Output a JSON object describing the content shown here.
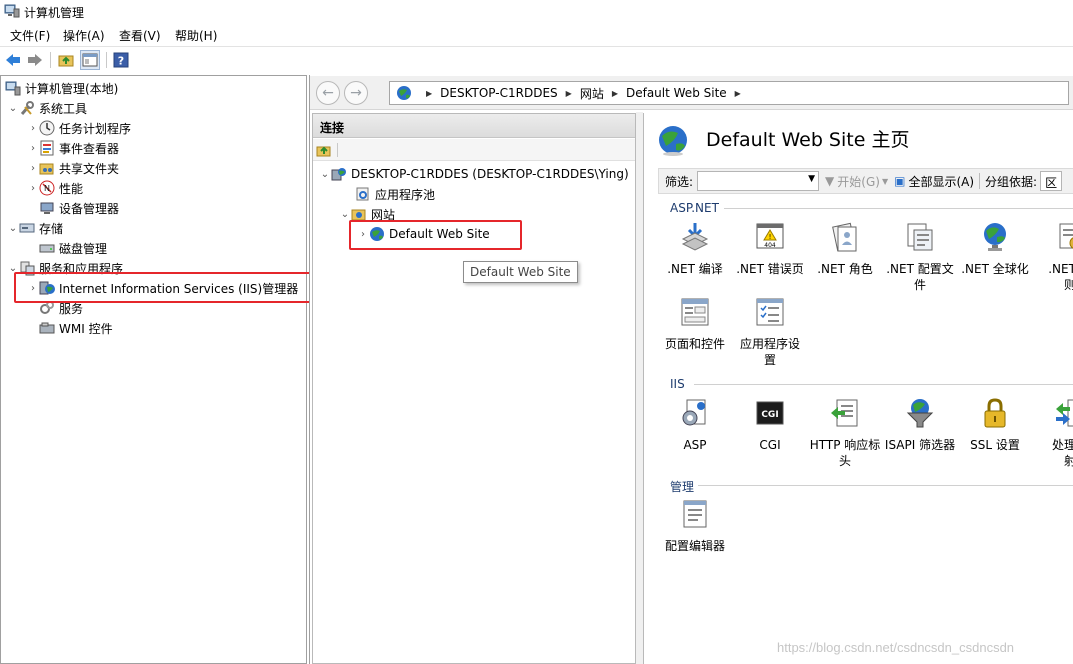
{
  "window": {
    "title": "计算机管理"
  },
  "menu": [
    "文件(F)",
    "操作(A)",
    "查看(V)",
    "帮助(H)"
  ],
  "left_tree": {
    "root": "计算机管理(本地)",
    "system_tools": "系统工具",
    "task_scheduler": "任务计划程序",
    "event_viewer": "事件查看器",
    "shared_folders": "共享文件夹",
    "performance": "性能",
    "device_manager": "设备管理器",
    "storage": "存储",
    "disk_management": "磁盘管理",
    "services_apps": "服务和应用程序",
    "iis_manager": "Internet Information Services (IIS)管理器",
    "services": "服务",
    "wmi": "WMI 控件"
  },
  "address_bar": {
    "crumbs": [
      "DESKTOP-C1RDDES",
      "网站",
      "Default Web Site"
    ]
  },
  "connections": {
    "header": "连接",
    "server": "DESKTOP-C1RDDES (DESKTOP-C1RDDES\\Ying)",
    "app_pools": "应用程序池",
    "sites": "网站",
    "default_site": "Default Web Site",
    "tooltip": "Default Web Site"
  },
  "home": {
    "title": "Default Web Site 主页",
    "filter_label": "筛选:",
    "start_label": "开始(G)",
    "show_all_label": "全部显示(A)",
    "group_by_label": "分组依据:",
    "group_by_value": "区"
  },
  "sections": {
    "aspnet": {
      "label": "ASP.NET",
      "items": [
        {
          "line1": ".NET 编译",
          "line2": ""
        },
        {
          "line1": ".NET 错误页",
          "line2": ""
        },
        {
          "line1": ".NET 角色",
          "line2": ""
        },
        {
          "line1": ".NET 配置文",
          "line2": "件"
        },
        {
          "line1": ".NET 全球化",
          "line2": ""
        },
        {
          "line1": ".NET 授",
          "line2": "则"
        },
        {
          "line1": "页面和控件",
          "line2": ""
        },
        {
          "line1": "应用程序设",
          "line2": "置"
        }
      ]
    },
    "iis": {
      "label": "IIS",
      "items": [
        {
          "line1": "ASP",
          "line2": ""
        },
        {
          "line1": "CGI",
          "line2": ""
        },
        {
          "line1": "HTTP 响应标",
          "line2": "头"
        },
        {
          "line1": "ISAPI 筛选器",
          "line2": ""
        },
        {
          "line1": "SSL 设置",
          "line2": ""
        },
        {
          "line1": "处理程",
          "line2": "射"
        }
      ]
    },
    "management": {
      "label": "管理",
      "items": [
        {
          "line1": "配置编辑器",
          "line2": ""
        }
      ]
    }
  },
  "icons": {
    "cgi_text": "CGI",
    "error_page_text": "404"
  },
  "watermark": "https://blog.csdn.net/csdncsdn_csdncsdn",
  "colors": {
    "highlight_box": "#e5262b",
    "section_label": "#1e3c6e",
    "globe_blue": "#2a6fc9",
    "globe_green": "#3aa23a"
  }
}
